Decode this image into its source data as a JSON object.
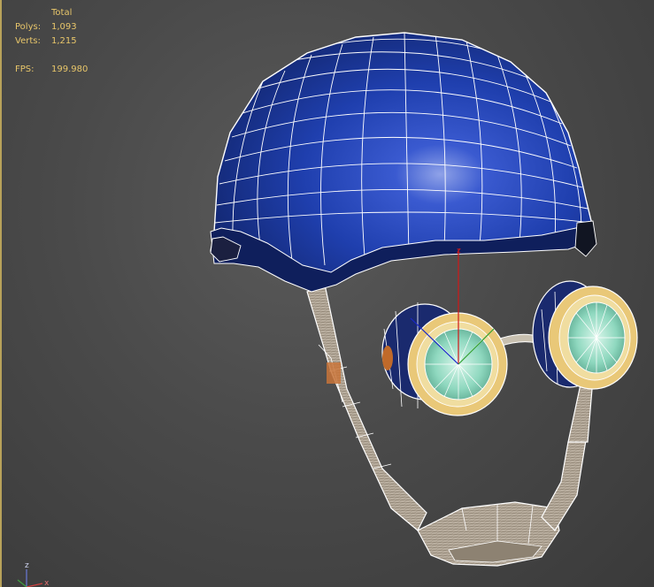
{
  "stats": {
    "header": "Total",
    "polys_label": "Polys:",
    "polys_value": "1,093",
    "verts_label": "Verts:",
    "verts_value": "1,215",
    "fps_label": "FPS:",
    "fps_value": "199.980"
  },
  "axis_gizmo": {
    "z": "z",
    "x": "x",
    "y": "y"
  },
  "colors": {
    "background": "#4a4a4a",
    "stats_text": "#e8c66a",
    "helmet_blue": "#1f3fae",
    "wire": "#ffffff",
    "lens": "#9fe0c8",
    "goggle_rim": "#e9c878"
  }
}
